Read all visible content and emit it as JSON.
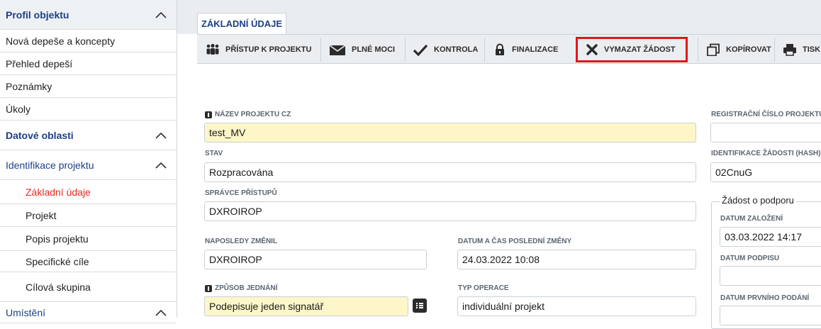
{
  "sidebar": {
    "rows": [
      {
        "label": "Profil objektu",
        "type": "header",
        "chevron": true
      },
      {
        "label": "Nová depeše a koncepty",
        "type": "item"
      },
      {
        "label": "Přehled depeší",
        "type": "item"
      },
      {
        "label": "Poznámky",
        "type": "item"
      },
      {
        "label": "Úkoly",
        "type": "item"
      },
      {
        "label": "Datové oblasti",
        "type": "header",
        "chevron": true
      },
      {
        "label": "Identifikace projektu",
        "type": "group",
        "chevron": true
      },
      {
        "label": "Základní údaje",
        "type": "sub",
        "active": true
      },
      {
        "label": "Projekt",
        "type": "sub"
      },
      {
        "label": "Popis projektu",
        "type": "sub"
      },
      {
        "label": "Specifické cíle",
        "type": "sub"
      },
      {
        "label": "Cílová skupina",
        "type": "sub"
      },
      {
        "label": "Umístění",
        "type": "group",
        "chevron": true
      }
    ]
  },
  "tab": {
    "label": "ZÁKLADNÍ ÚDAJE"
  },
  "toolbar": {
    "buttons": [
      {
        "label": "PŘÍSTUP K PROJEKTU",
        "icon": "people-icon"
      },
      {
        "label": "PLNÉ MOCI",
        "icon": "envelope-icon"
      },
      {
        "label": "KONTROLA",
        "icon": "check-icon"
      },
      {
        "label": "FINALIZACE",
        "icon": "lock-icon"
      },
      {
        "label": "VYMAZAT ŽÁDOST",
        "icon": "x-icon"
      },
      {
        "label": "KOPÍROVAT",
        "icon": "copy-icon"
      },
      {
        "label": "TISK",
        "icon": "print-icon"
      }
    ]
  },
  "form": {
    "nazev_label": "NÁZEV PROJEKTU CZ",
    "nazev_value": "test_MV",
    "stav_label": "STAV",
    "stav_value": "Rozpracována",
    "spravce_label": "SPRÁVCE PŘÍSTUPŮ",
    "spravce_value": "DXROIROP",
    "zmenil_label": "NAPOSLEDY ZMĚNIL",
    "zmenil_value": "DXROIROP",
    "datum_zmeny_label": "DATUM A ČAS POSLEDNÍ ZMĚNY",
    "datum_zmeny_value": "24.03.2022 10:08",
    "zpusob_label": "ZPŮSOB JEDNÁNÍ",
    "zpusob_value": "Podepisuje jeden signatář",
    "typ_label": "TYP OPERACE",
    "typ_value": "individuální projekt",
    "reg_label": "REGISTRAČNÍ ČÍSLO PROJEKTU",
    "reg_value": "",
    "hash_label": "IDENTIFIKACE ŽÁDOSTI (HASH)",
    "hash_value": "02CnuG",
    "zadost_legend": "Žádost o podporu",
    "zalozeni_label": "DATUM ZALOŽENÍ",
    "zalozeni_value": "03.03.2022 14:17",
    "podpis_label": "DATUM PODPISU",
    "podpis_value": "",
    "podani_label": "DATUM PRVNÍHO PODÁNÍ"
  },
  "colors": {
    "accent": "#1d3f86",
    "active": "#e5291c",
    "highlight": "#e3161b",
    "required_bg": "#fdf6c8"
  }
}
